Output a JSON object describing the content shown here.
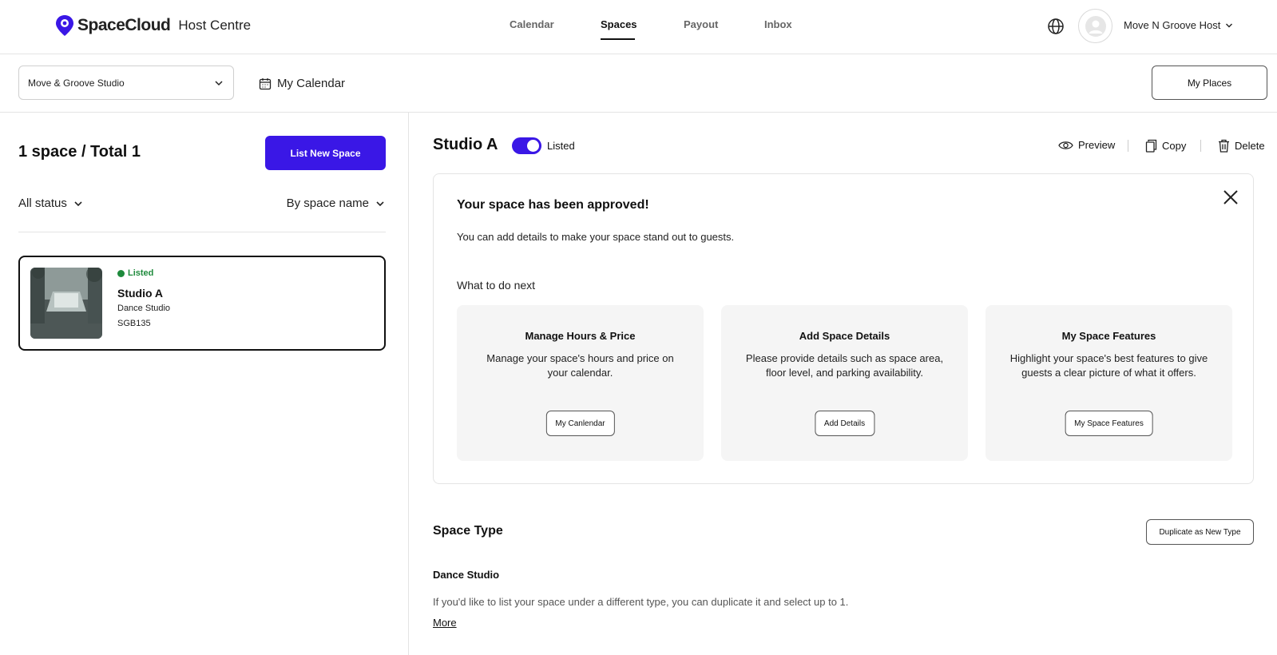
{
  "header": {
    "logo_text": "SpaceCloud",
    "logo_sub": "Host Centre",
    "nav": [
      {
        "label": "Calendar",
        "active": false
      },
      {
        "label": "Spaces",
        "active": true
      },
      {
        "label": "Payout",
        "active": false
      },
      {
        "label": "Inbox",
        "active": false
      }
    ],
    "user_name": "Move N Groove Host"
  },
  "subbar": {
    "selected_place": "Move & Groove Studio",
    "calendar_link": "My Calendar",
    "my_places_label": "My Places"
  },
  "left": {
    "count_title": "1 space / Total 1",
    "list_new_label": "List New Space",
    "status_filter": "All status",
    "sort_filter": "By space name",
    "spaces": [
      {
        "status": "Listed",
        "name": "Studio A",
        "type": "Dance Studio",
        "code": "SGB135"
      }
    ]
  },
  "detail": {
    "title": "Studio A",
    "toggle_label": "Listed",
    "actions": {
      "preview": "Preview",
      "copy": "Copy",
      "delete": "Delete"
    },
    "approval": {
      "title": "Your space has been approved!",
      "description": "You can add details to make your space stand out to guests.",
      "next_title": "What to do next",
      "cards": [
        {
          "title": "Manage Hours & Price",
          "desc": "Manage your space's hours and price on your calendar.",
          "button": "My Canlendar"
        },
        {
          "title": "Add Space Details",
          "desc": "Please provide details such as space area, floor level, and parking availability.",
          "button": "Add Details"
        },
        {
          "title": "My Space Features",
          "desc": "Highlight your space's best features to give guests a clear picture of what it offers.",
          "button": "My Space Features"
        }
      ]
    },
    "space_type": {
      "section_title": "Space Type",
      "duplicate_label": "Duplicate as New Type",
      "type_name": "Dance Studio",
      "description": "If you'd like to list your space under a different type, you can duplicate it and select up to 1.",
      "more_label": "More"
    }
  },
  "colors": {
    "accent": "#3a17e6",
    "listed_green": "#1e8a3c"
  }
}
